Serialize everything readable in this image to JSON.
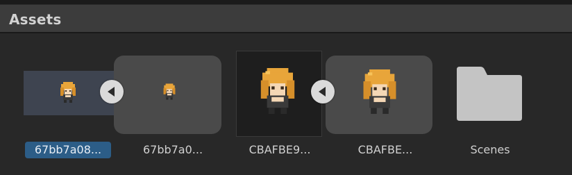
{
  "panel": {
    "title": "Assets"
  },
  "items": [
    {
      "label": "67bb7a08...",
      "selected": true,
      "kind": "sprite-texture",
      "icon": "character-sprite-icon"
    },
    {
      "label": "67bb7a0...",
      "selected": false,
      "kind": "sprite",
      "icon": "character-sprite-icon"
    },
    {
      "label": "CBAFBE9...",
      "selected": false,
      "kind": "sprite-texture",
      "icon": "character-sprite-icon"
    },
    {
      "label": "CBAFBE...",
      "selected": false,
      "kind": "sprite",
      "icon": "character-sprite-icon"
    },
    {
      "label": "Scenes",
      "selected": false,
      "kind": "folder",
      "icon": "folder-icon"
    }
  ],
  "colors": {
    "selection": "#2c5d87",
    "sprite_hair": "#e8a53a",
    "sprite_skin": "#f4d7b5",
    "sprite_outfit": "#3a3a3a",
    "folder": "#c4c4c4"
  }
}
